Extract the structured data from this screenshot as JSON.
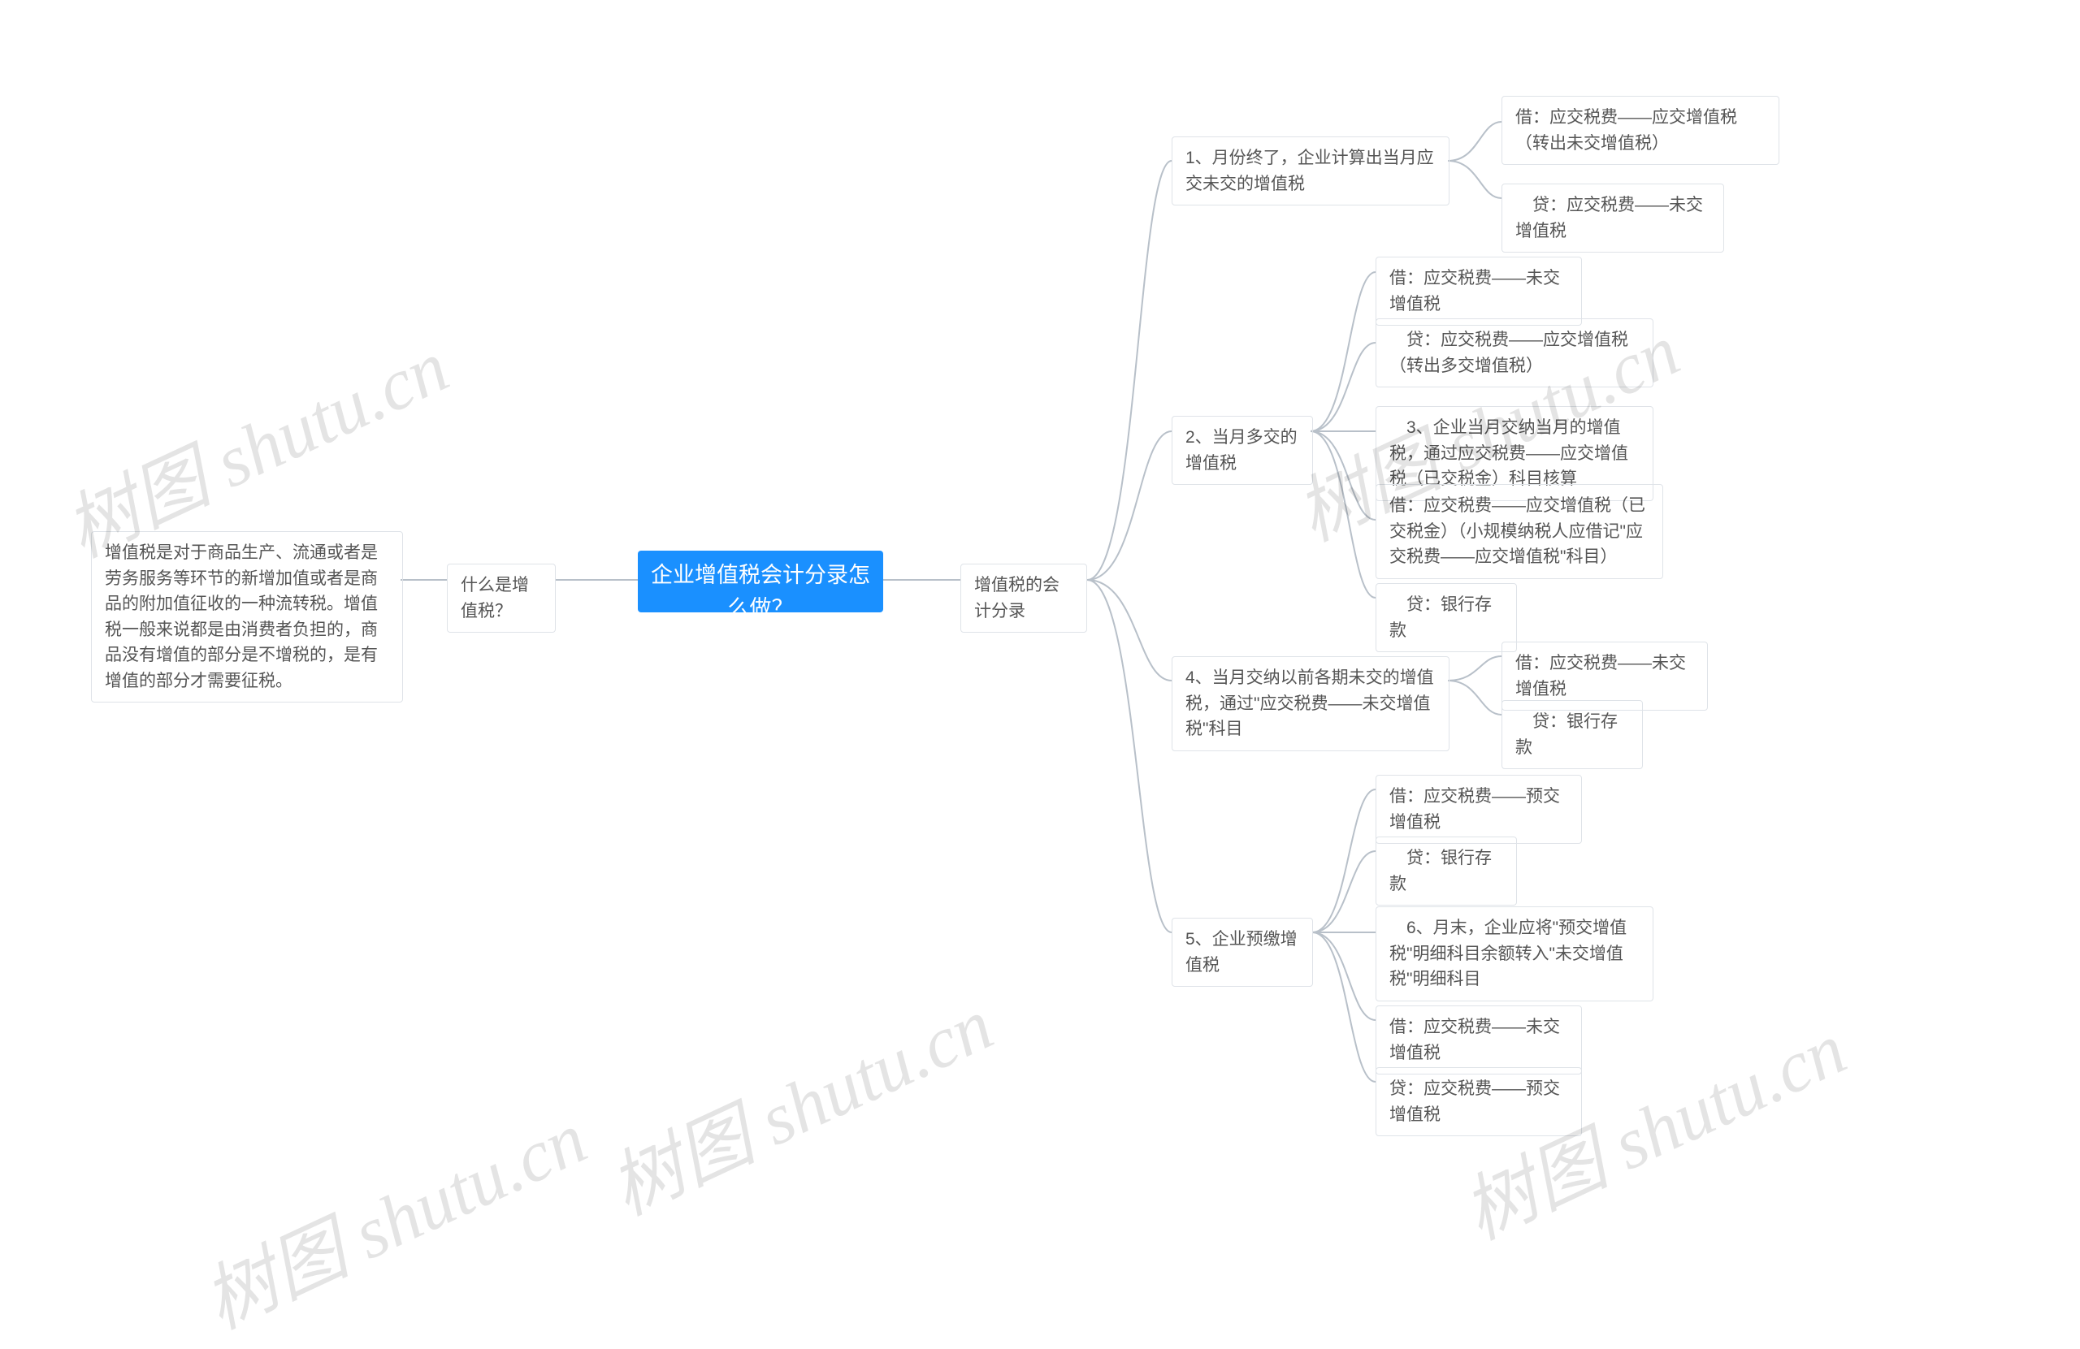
{
  "watermark": "树图 shutu.cn",
  "root": {
    "text": "企业增值税会计分录怎么做？"
  },
  "left": {
    "q": {
      "text": "什么是增值税？"
    },
    "a": {
      "text": "增值税是对于商品生产、流通或者是劳务服务等环节的新增加值或者是商品的附加值征收的一种流转税。增值税一般来说都是由消费者负担的，商品没有增值的部分是不增税的，是有增值的部分才需要征税。"
    }
  },
  "right": {
    "head": {
      "text": "增值税的会计分录"
    },
    "n1": {
      "text": "1、月份终了，企业计算出当月应交未交的增值税"
    },
    "n1a": {
      "text": "借：应交税费——应交增值税（转出未交增值税）"
    },
    "n1b": {
      "text": "　贷：应交税费——未交增值税"
    },
    "n2": {
      "text": "2、当月多交的增值税"
    },
    "n2a": {
      "text": "借：应交税费——未交增值税"
    },
    "n2b": {
      "text": "　贷：应交税费——应交增值税（转出多交增值税）"
    },
    "n2c": {
      "text": "　3、企业当月交纳当月的增值税，通过应交税费——应交增值税（已交税金）科目核算"
    },
    "n2d": {
      "text": "借：应交税费——应交增值税（已交税金）（小规模纳税人应借记\"应交税费——应交增值税\"科目）"
    },
    "n2e": {
      "text": "　贷：银行存款"
    },
    "n4": {
      "text": "4、当月交纳以前各期未交的增值税，通过\"应交税费——未交增值税\"科目"
    },
    "n4a": {
      "text": "借：应交税费——未交增值税"
    },
    "n4b": {
      "text": "　贷：银行存款"
    },
    "n5": {
      "text": "5、企业预缴增值税"
    },
    "n5a": {
      "text": "借：应交税费——预交增值税"
    },
    "n5b": {
      "text": "　贷：银行存款"
    },
    "n5c": {
      "text": "　6、月末，企业应将\"预交增值税\"明细科目余额转入\"未交增值税\"明细科目"
    },
    "n5d": {
      "text": "借：应交税费——未交增值税"
    },
    "n5e": {
      "text": "贷：应交税费——预交增值税"
    }
  }
}
